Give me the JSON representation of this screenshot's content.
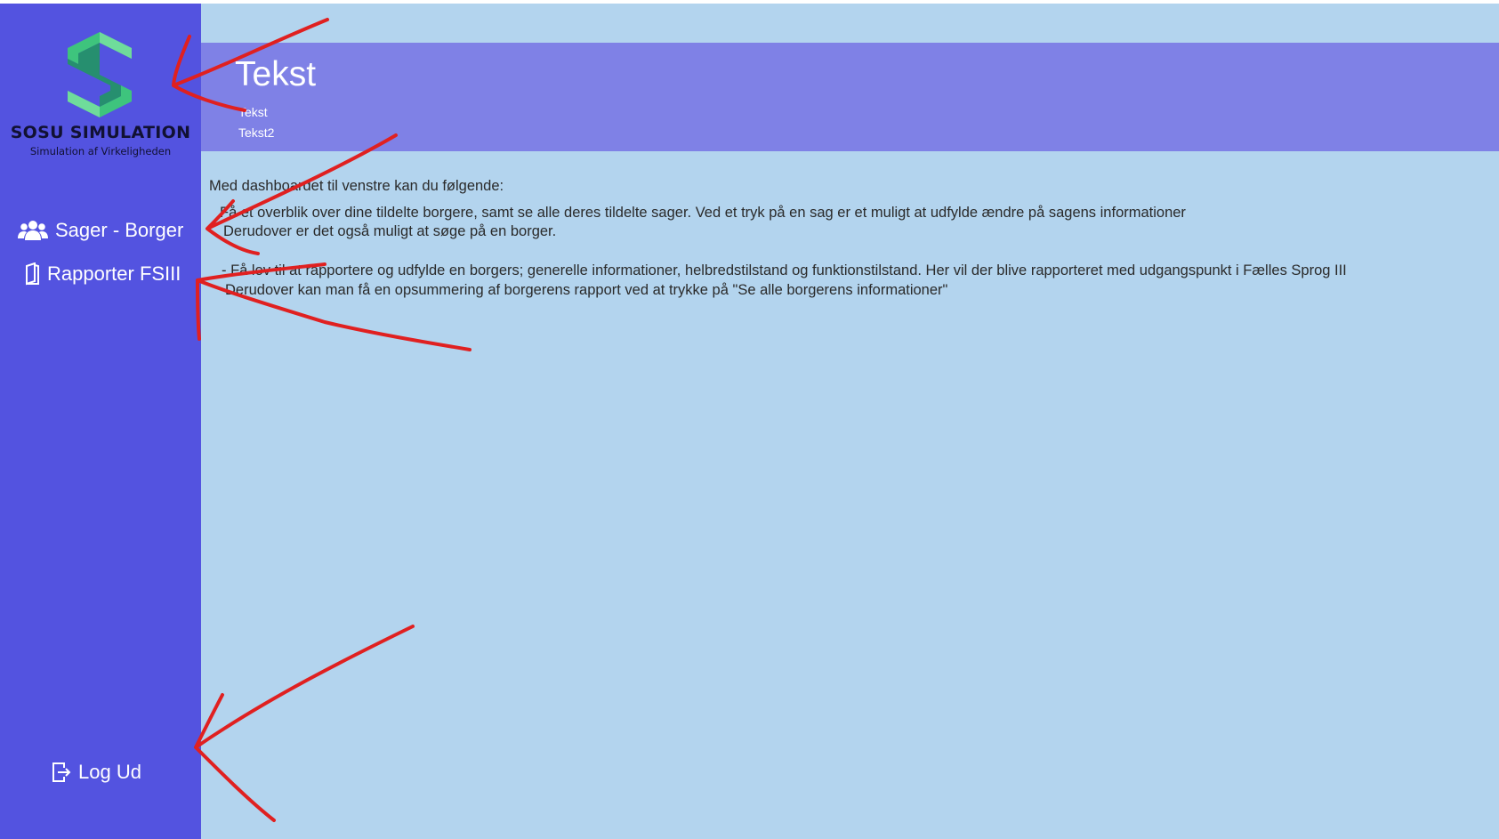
{
  "sidebar": {
    "logo": {
      "title": "SOSU SIMULATION",
      "subtitle": "Simulation af Virkeligheden",
      "colors": [
        "#3ec47d",
        "#1e9a5a",
        "#6fdc9b"
      ]
    },
    "items": [
      {
        "label": "Sager - Borger",
        "icon": "people-icon"
      },
      {
        "label": "Rapporter FSIII",
        "icon": "document-icon"
      }
    ],
    "logout": {
      "label": "Log Ud",
      "icon": "logout-icon"
    }
  },
  "header": {
    "title": "Tekst",
    "sub1": "Tekst",
    "sub2": "Tekst2"
  },
  "content": {
    "intro": "Med dashboardet til venstre kan du følgende:",
    "item1_line1": "Få et overblik over dine tildelte borgere, samt se alle deres tildelte sager. Ved et tryk på en sag er et muligt at udfylde ændre på sagens  informationer",
    "item1_line2": "Derudover er det også muligt at søge på en borger.",
    "item2_line1": "- Få lov til at rapportere og udfylde en borgers; generelle informationer, helbredstilstand og funktionstilstand. Her vil der blive rapporteret med udgangspunkt i Fælles Sprog III",
    "item2_line2": "Derudover kan man få en opsummering af borgerens rapport ved at trykke på \"Se alle borgerens informationer\""
  },
  "colors": {
    "sidebar": "#5353e0",
    "header": "#7f81e6",
    "background": "#b3d4ee",
    "annotation": "#e02020"
  }
}
